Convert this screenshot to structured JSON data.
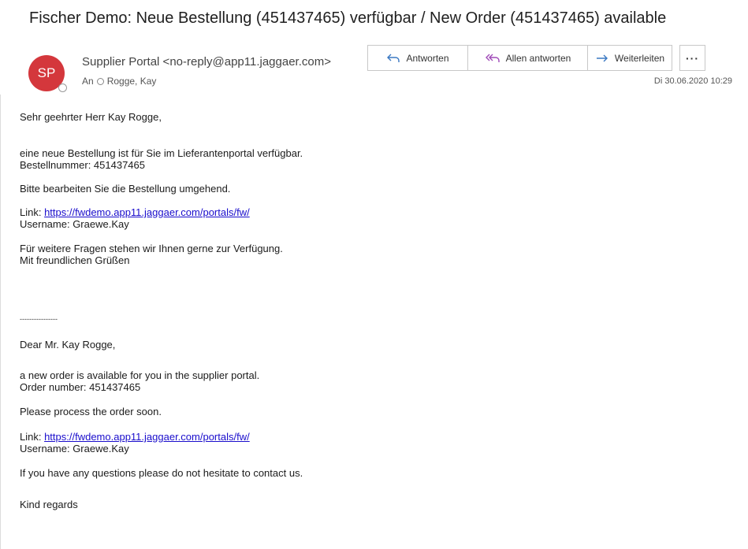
{
  "subject": "Fischer Demo: Neue Bestellung (451437465) verfügbar / New Order (451437465) available",
  "sender": {
    "initials": "SP",
    "display": "Supplier Portal <no-reply@app11.jaggaer.com>",
    "to_label": "An",
    "to": "Rogge, Kay"
  },
  "actions": {
    "reply": "Antworten",
    "reply_all": "Allen antworten",
    "forward": "Weiterleiten",
    "more": "···"
  },
  "date": "Di 30.06.2020 10:29",
  "body": {
    "de_greeting": "Sehr geehrter Herr Kay Rogge,",
    "de_line1": "eine neue Bestellung ist für Sie im Lieferantenportal verfügbar.",
    "de_line2": "Bestellnummer: 451437465",
    "de_line3": "Bitte bearbeiten Sie die Bestellung umgehend.",
    "link_label": "Link: ",
    "link_url": "https://fwdemo.app11.jaggaer.com/portals/fw/",
    "username": "Username: Graewe.Kay",
    "de_line4": "Für weitere Fragen stehen wir Ihnen gerne zur Verfügung.",
    "de_line5": "Mit freundlichen Grüßen",
    "separator": "----------------",
    "en_greeting": "Dear Mr. Kay Rogge,",
    "en_line1": "a new order is available for you in the supplier portal.",
    "en_line2": "Order number: 451437465",
    "en_line3": "Please process the order soon.",
    "en_line4": "If you have any questions please do not hesitate to contact us.",
    "en_line5": "Kind regards"
  }
}
